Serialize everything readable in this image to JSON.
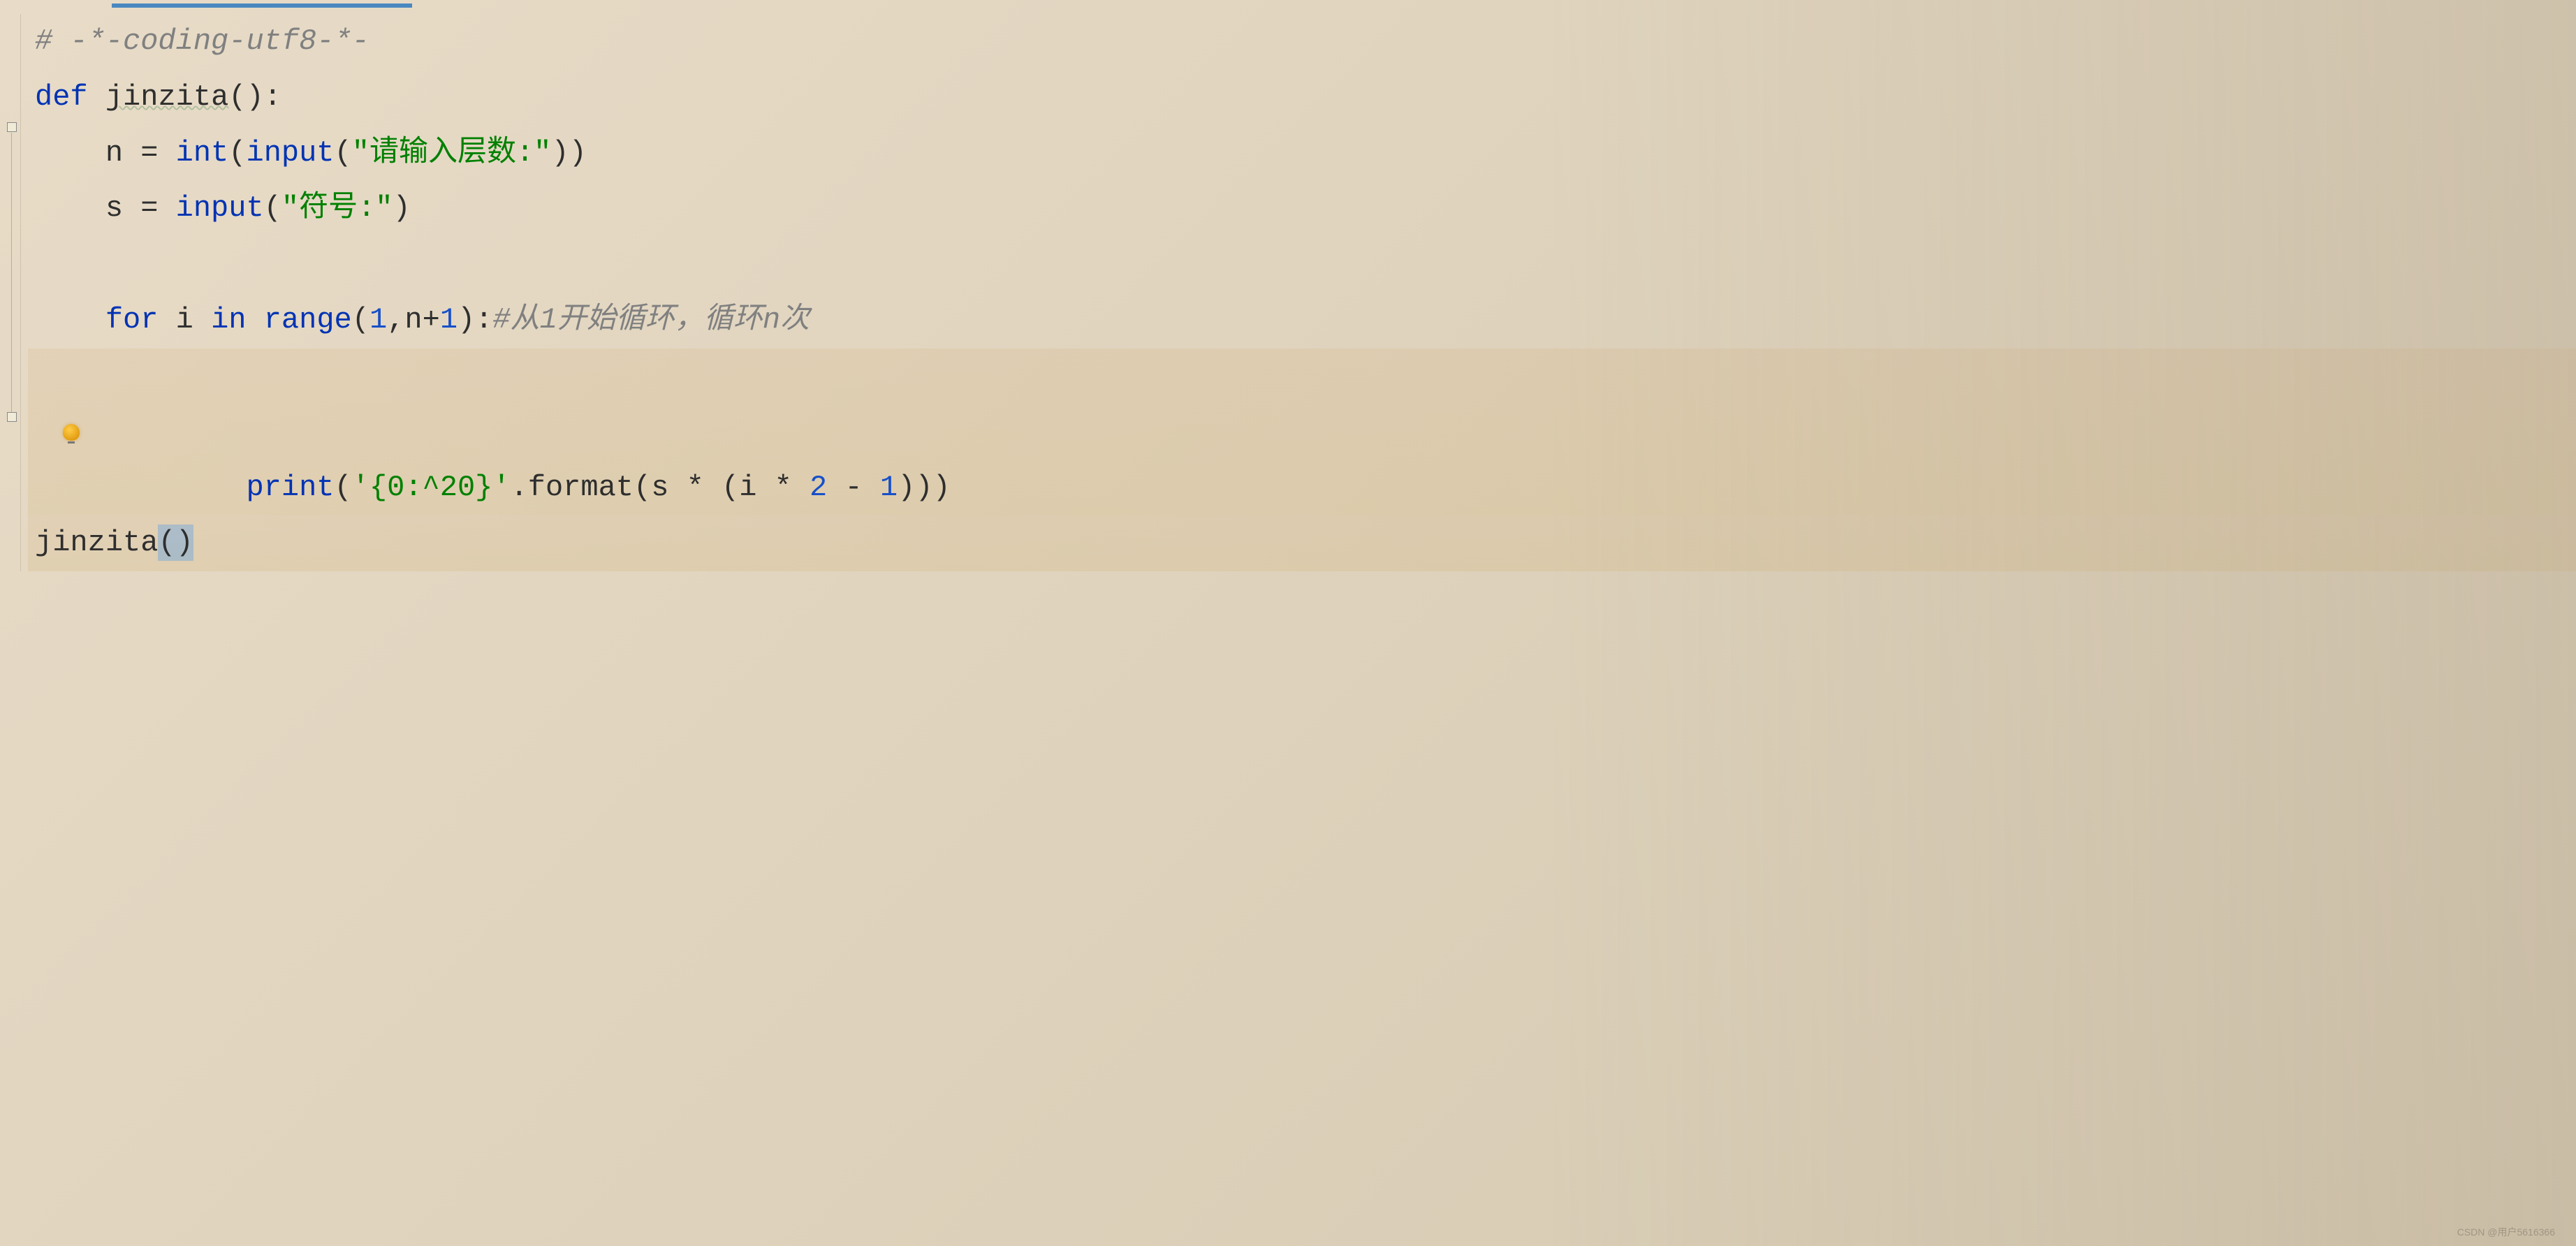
{
  "code": {
    "line1_comment": "# -*-coding-utf8-*-",
    "line2_def": "def",
    "line2_funcname": "jinzita",
    "line2_rest": "():",
    "line3_indent": "    n = ",
    "line3_builtin1": "int",
    "line3_paren1": "(",
    "line3_builtin2": "input",
    "line3_paren2": "(",
    "line3_string": "\"请输入层数:\"",
    "line3_close": "))",
    "line4_indent": "    s = ",
    "line4_builtin": "input",
    "line4_paren": "(",
    "line4_string": "\"符号:\"",
    "line4_close": ")",
    "line6_indent": "    ",
    "line6_for": "for",
    "line6_space1": " i ",
    "line6_in": "in",
    "line6_space2": " ",
    "line6_range": "range",
    "line6_open": "(",
    "line6_num1": "1",
    "line6_comma": ",n+",
    "line6_num2": "1",
    "line6_close": "):",
    "line6_comment": "#从1开始循环，循环n次",
    "line7_indent": "        ",
    "line7_print": "print",
    "line7_open": "(",
    "line7_string": "'{0:^20}'",
    "line7_format": ".format(s * (i * ",
    "line7_num1": "2",
    "line7_minus": " - ",
    "line7_num2": "1",
    "line7_close": ")))",
    "line8_call": "jinzita",
    "line8_parens": "()"
  },
  "watermark": "CSDN @用户5616366"
}
